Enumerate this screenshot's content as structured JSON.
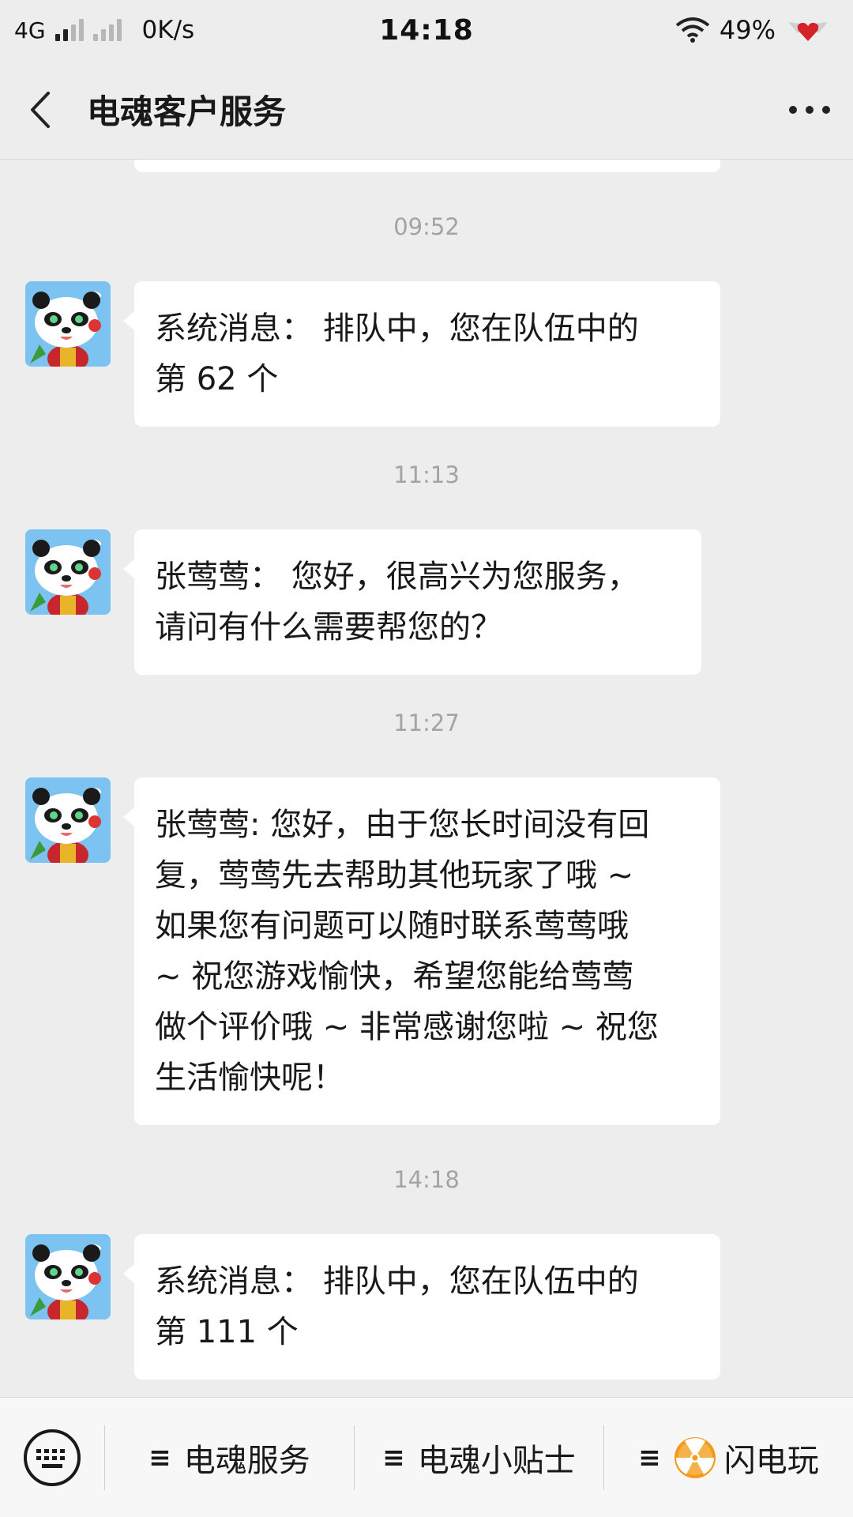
{
  "status_bar": {
    "network": "4G",
    "speed": "0K/s",
    "time": "14:18",
    "battery": "49%"
  },
  "header": {
    "title": "电魂客户服务"
  },
  "messages": [
    {
      "time": "09:52",
      "text_lines": [
        "系统消息： 排队中，您在队伍中的",
        "第 62 个"
      ]
    },
    {
      "time": "11:13",
      "text_lines": [
        "张莺莺： 您好，很高兴为您服务，",
        "请问有什么需要帮您的？"
      ]
    },
    {
      "time": "11:27",
      "text_lines": [
        "张莺莺: 您好，由于您长时间没有回",
        "复，莺莺先去帮助其他玩家了哦 ~",
        "如果您有问题可以随时联系莺莺哦",
        "~ 祝您游戏愉快，希望您能给莺莺",
        "做个评价哦 ~ 非常感谢您啦 ~ 祝您",
        "生活愉快呢！"
      ]
    },
    {
      "time": "14:18",
      "text_lines": [
        "系统消息： 排队中，您在队伍中的",
        "第 111 个"
      ]
    }
  ],
  "menu": {
    "hamburger": "≡",
    "items": [
      "电魂服务",
      "电魂小贴士",
      "闪电玩"
    ]
  },
  "icons": {
    "back": "chevron-left-icon",
    "more": "more-dots-icon",
    "keyboard": "keyboard-icon",
    "radiation": "radiation-icon"
  },
  "colors": {
    "background": "#ededed",
    "bubble": "#ffffff",
    "timestamp": "#a3a3a3",
    "avatar_bg": "#7cc3f2"
  }
}
